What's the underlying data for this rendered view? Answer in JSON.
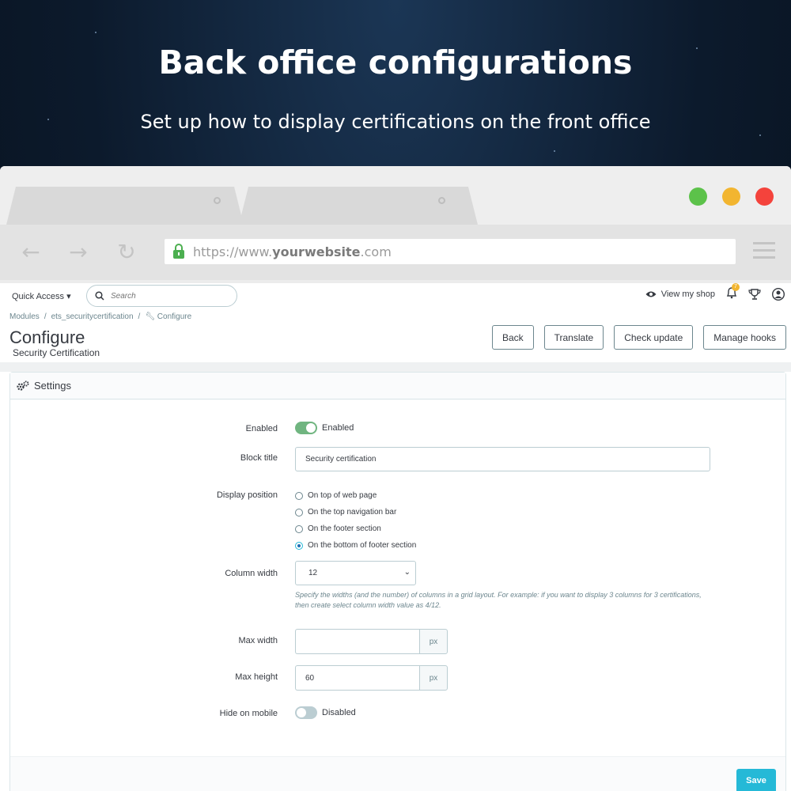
{
  "hero": {
    "title": "Back office configurations",
    "subtitle": "Set up how to display certifications on the front office"
  },
  "browser": {
    "url_prefix": "https://www.",
    "url_domain": "yourwebsite",
    "url_suffix": ".com",
    "window_colors": {
      "green": "#5cc24a",
      "yellow": "#f2b530",
      "red": "#f4433c"
    }
  },
  "topbar": {
    "quick_access": "Quick Access",
    "search_placeholder": "Search",
    "view_shop": "View my shop",
    "notifications_count": "7"
  },
  "breadcrumb": {
    "items": [
      "Modules",
      "ets_securitycertification",
      "Configure"
    ]
  },
  "header": {
    "title": "Configure",
    "subtitle": "Security Certification",
    "buttons": [
      "Back",
      "Translate",
      "Check update",
      "Manage hooks"
    ]
  },
  "panel": {
    "title": "Settings"
  },
  "form": {
    "enabled": {
      "label": "Enabled",
      "state": "Enabled",
      "on": true
    },
    "block_title": {
      "label": "Block title",
      "value": "Security certification"
    },
    "display_position": {
      "label": "Display position",
      "options": [
        "On top of web page",
        "On the top navigation bar",
        "On the footer section",
        "On the bottom of footer section"
      ],
      "selected_index": 3
    },
    "column_width": {
      "label": "Column width",
      "value": "12",
      "help": "Specify the widths (and the number) of columns in a grid layout. For example: if you want to display 3 columns for 3 certifications, then create select column width value as 4/12."
    },
    "max_width": {
      "label": "Max width",
      "value": "",
      "unit": "px"
    },
    "max_height": {
      "label": "Max height",
      "value": "60",
      "unit": "px"
    },
    "hide_on_mobile": {
      "label": "Hide on mobile",
      "state": "Disabled",
      "on": false
    }
  },
  "footer": {
    "save_label": "Save"
  },
  "colors": {
    "accent": "#25b9d7",
    "switch_on": "#70b580",
    "switch_off": "#bbcdd2"
  }
}
